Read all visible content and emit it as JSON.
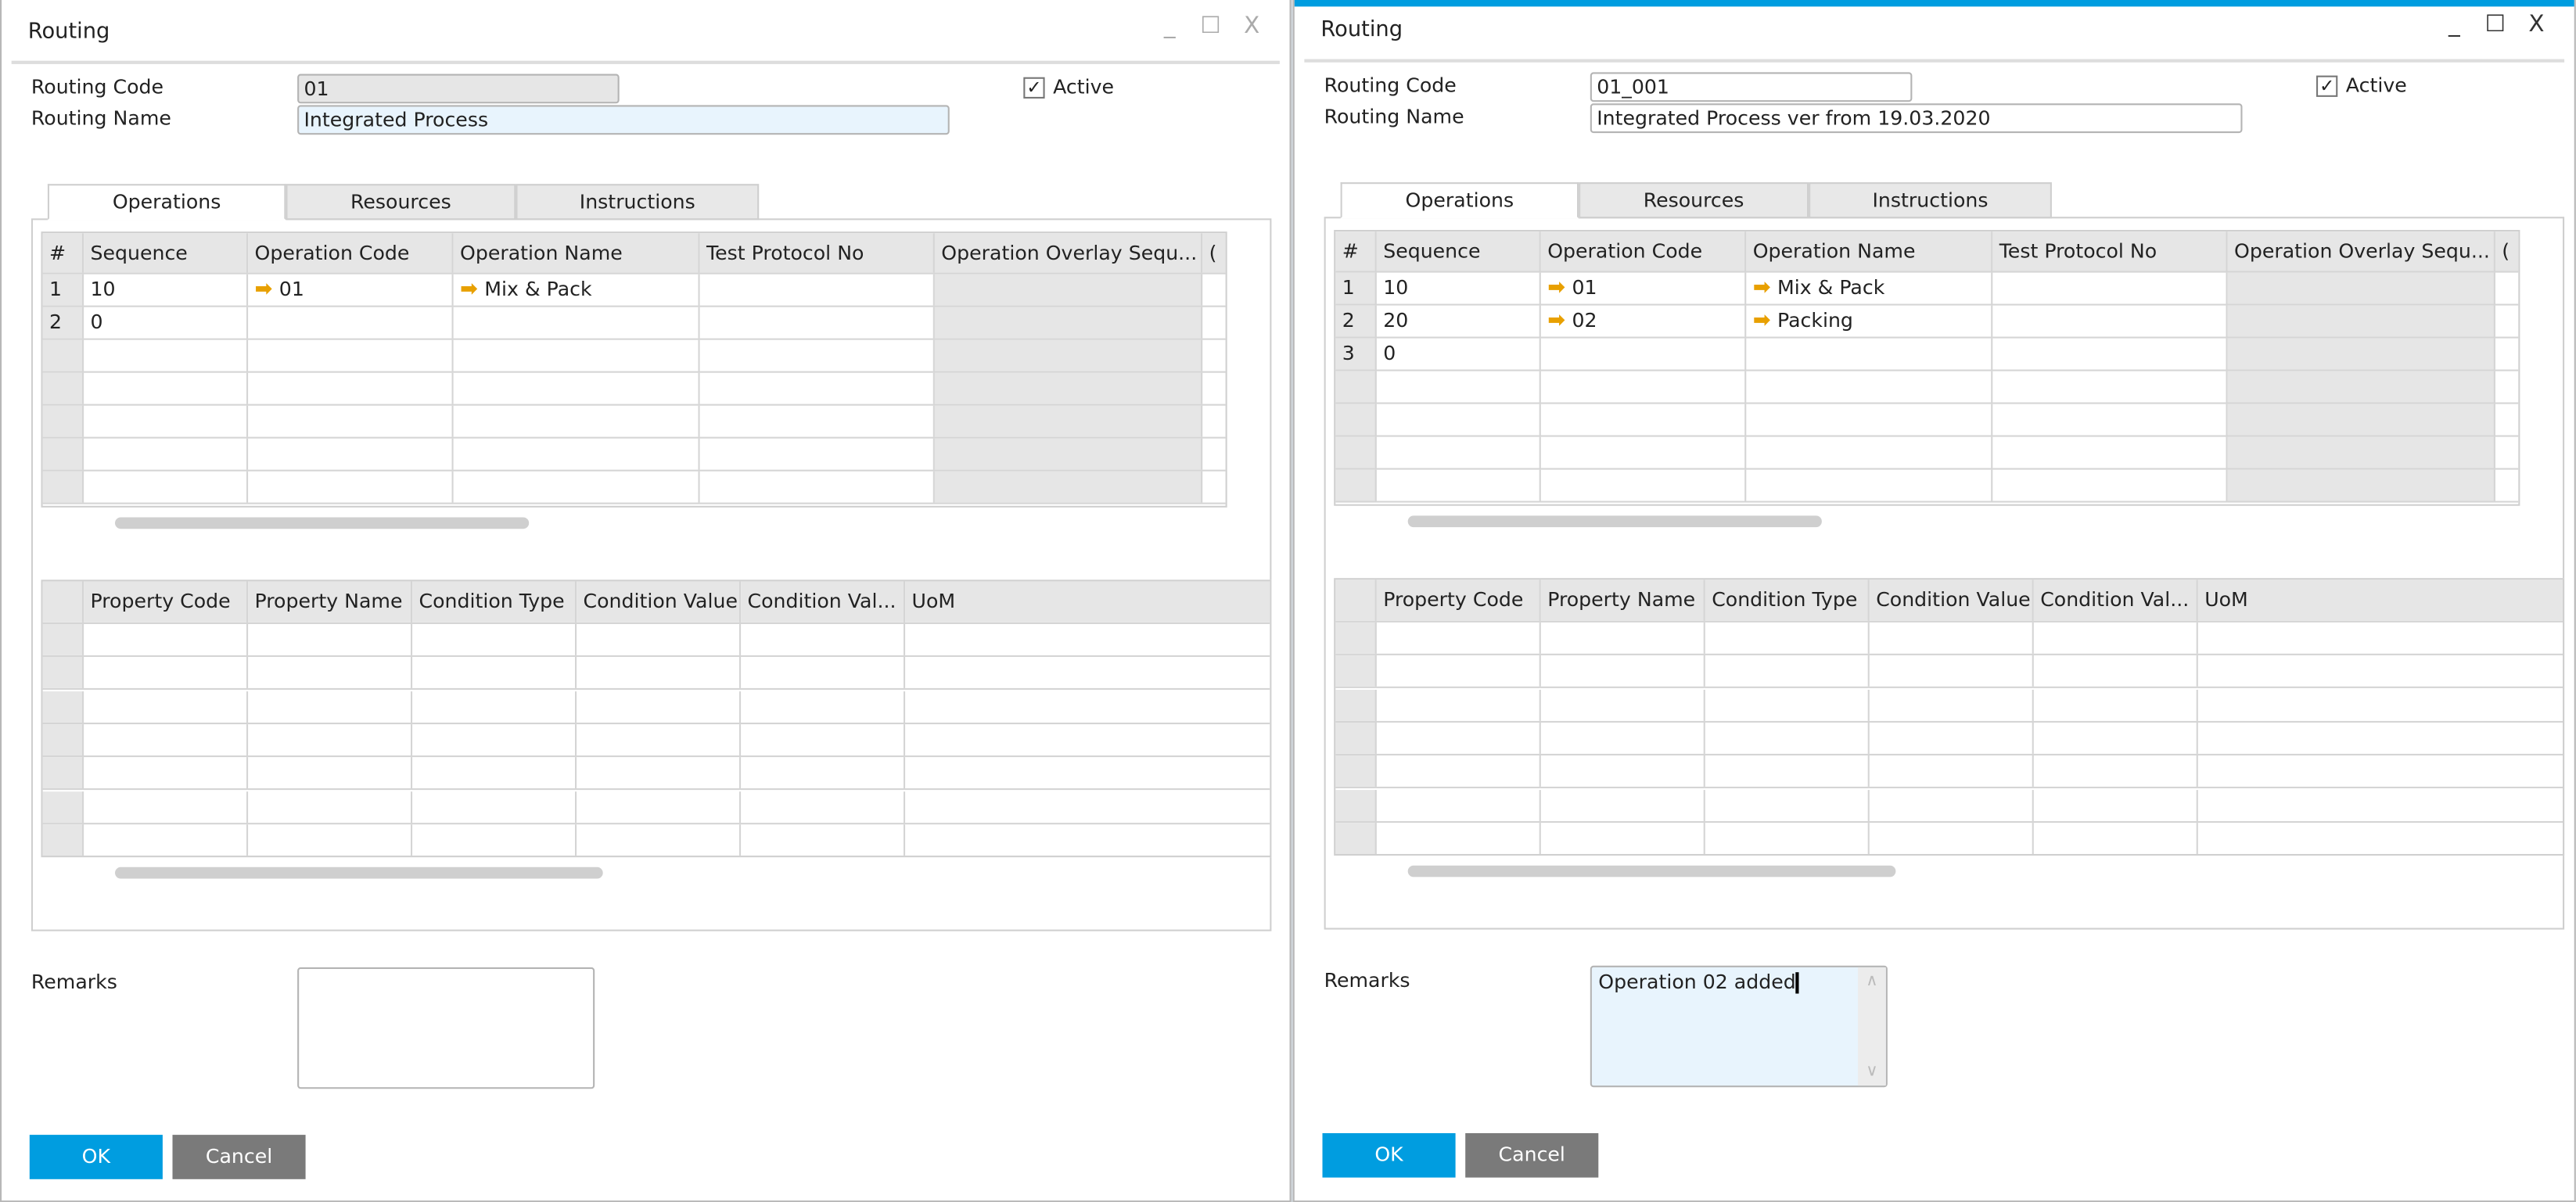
{
  "windows": [
    {
      "id": "left",
      "title": "Routing",
      "controls": {
        "minimize": "_",
        "maximize": "☐",
        "close": "X"
      },
      "routing_code_label": "Routing Code",
      "routing_code": "01",
      "routing_name_label": "Routing Name",
      "routing_name": "Integrated Process",
      "active_label": "Active",
      "active_checked": "✓",
      "tabs": [
        "Operations",
        "Resources",
        "Instructions"
      ],
      "operations_columns": [
        "#",
        "Sequence",
        "Operation Code",
        "Operation Name",
        "Test Protocol No",
        "Operation Overlay Sequ...",
        "("
      ],
      "operations_rows": [
        {
          "num": "1",
          "sequence": "10",
          "code": "01",
          "name": "Mix & Pack"
        },
        {
          "num": "2",
          "sequence": "0",
          "code": "",
          "name": ""
        }
      ],
      "properties_columns": [
        "",
        "Property Code",
        "Property Name",
        "Condition Type",
        "Condition Value",
        "Condition Val...",
        "UoM"
      ],
      "remarks_label": "Remarks",
      "remarks": "",
      "ok_label": "OK",
      "cancel_label": "Cancel"
    },
    {
      "id": "right",
      "title": "Routing",
      "controls": {
        "minimize": "_",
        "maximize": "☐",
        "close": "X"
      },
      "routing_code_label": "Routing Code",
      "routing_code": "01_001",
      "routing_name_label": "Routing Name",
      "routing_name": "Integrated Process ver from 19.03.2020",
      "active_label": "Active",
      "active_checked": "✓",
      "tabs": [
        "Operations",
        "Resources",
        "Instructions"
      ],
      "operations_columns": [
        "#",
        "Sequence",
        "Operation Code",
        "Operation Name",
        "Test Protocol No",
        "Operation Overlay Sequ...",
        "("
      ],
      "operations_rows": [
        {
          "num": "1",
          "sequence": "10",
          "code": "01",
          "name": "Mix & Pack"
        },
        {
          "num": "2",
          "sequence": "20",
          "code": "02",
          "name": "Packing"
        },
        {
          "num": "3",
          "sequence": "0",
          "code": "",
          "name": ""
        }
      ],
      "properties_columns": [
        "",
        "Property Code",
        "Property Name",
        "Condition Type",
        "Condition Value",
        "Condition Val...",
        "UoM"
      ],
      "remarks_label": "Remarks",
      "remarks": "Operation 02 added",
      "ok_label": "OK",
      "cancel_label": "Cancel"
    }
  ],
  "colors": {
    "accent": "#009de0",
    "cancel": "#7a7a7a",
    "focus_field": "#e8f4fd",
    "link_arrow": "#e8a000"
  }
}
